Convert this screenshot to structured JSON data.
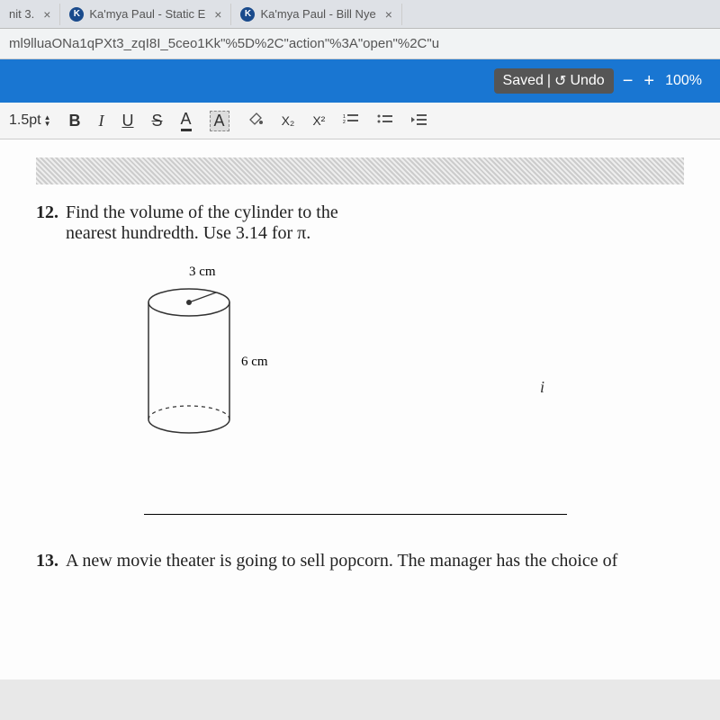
{
  "tabs": [
    {
      "label": "nit 3.",
      "has_icon": false
    },
    {
      "label": "Ka'mya Paul - Static E",
      "has_icon": true,
      "icon_letter": "K"
    },
    {
      "label": "Ka'mya Paul - Bill Nye",
      "has_icon": true,
      "icon_letter": "K"
    }
  ],
  "url_bar": "ml9lluaONa1qPXt3_zqI8I_5ceo1Kk\"%5D%2C\"action\"%3A\"open\"%2C\"u",
  "header": {
    "saved_label": "Saved",
    "undo_label": "Undo",
    "zoom_minus": "−",
    "zoom_plus": "+",
    "zoom_level": "100%"
  },
  "toolbar": {
    "font_size": "1.5pt",
    "bold": "B",
    "italic": "I",
    "underline": "U",
    "strike": "S",
    "font_color": "A",
    "highlight": "A",
    "subscript": "X₂",
    "superscript": "X²"
  },
  "question12": {
    "number": "12.",
    "text_line1": "Find the volume of the cylinder to the",
    "text_line2": "nearest hundredth. Use 3.14 for π.",
    "radius_label": "3 cm",
    "height_label": "6 cm"
  },
  "question13": {
    "number": "13.",
    "text": "A new movie theater is going to sell popcorn. The manager has the choice of"
  },
  "stray": {
    "i": "i"
  }
}
